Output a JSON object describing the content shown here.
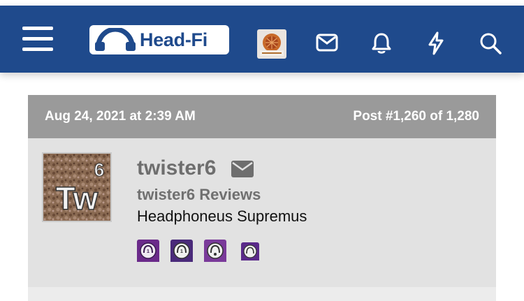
{
  "app": {
    "brand": "Head-Fi",
    "colors": {
      "nav_bg": "#1f4a8c",
      "header_bg": "#9a9a9a",
      "card_bg": "#e2e2e2"
    }
  },
  "nav": {
    "icons": [
      "menu-icon",
      "head-fi-logo",
      "user-avatar",
      "envelope-icon",
      "bell-icon",
      "lightning-icon",
      "search-icon"
    ]
  },
  "post": {
    "date": "Aug 24, 2021 at 2:39 AM",
    "number": "Post #1,260 of 1,280",
    "author": {
      "name": "twister6",
      "subtitle": "twister6 Reviews",
      "title": "Headphoneus Supremus",
      "avatar_text": "Tw",
      "avatar_number": "6"
    },
    "badges": [
      "badge-1",
      "badge-2",
      "badge-3",
      "badge-4"
    ]
  }
}
